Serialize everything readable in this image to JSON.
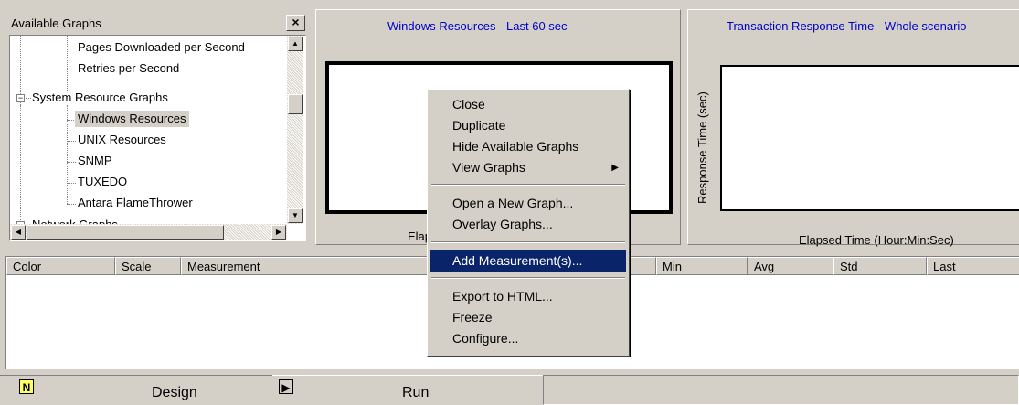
{
  "tree": {
    "title": "Available Graphs",
    "close_label": "×",
    "items": [
      {
        "label": "Pages Downloaded per Second"
      },
      {
        "label": "Retries per Second"
      },
      {
        "label": "System Resource Graphs",
        "expander": "−"
      },
      {
        "label": "Windows Resources",
        "selected": true
      },
      {
        "label": "UNIX Resources"
      },
      {
        "label": "SNMP"
      },
      {
        "label": "TUXEDO"
      },
      {
        "label": "Antara FlameThrower"
      },
      {
        "label": "Network Graphs",
        "expander": "−"
      }
    ]
  },
  "graph_windows": {
    "title": "Windows Resources - Last 60 sec",
    "xlabel_partial": "Elap"
  },
  "graph_transaction": {
    "title": "Transaction Response Time - Whole scenario",
    "ylabel": "Response Time (sec)",
    "xlabel": "Elapsed Time (Hour:Min:Sec)"
  },
  "table": {
    "columns": [
      "Color",
      "Scale",
      "Measurement",
      "Min",
      "Avg",
      "Std",
      "Last"
    ]
  },
  "context_menu": {
    "items": [
      "Close",
      "Duplicate",
      "Hide Available Graphs",
      "View Graphs",
      "Open a New Graph...",
      "Overlay Graphs...",
      "Add Measurement(s)...",
      "Export to HTML...",
      "Freeze",
      "Configure..."
    ],
    "submenu_arrow": "▶"
  },
  "tabs": {
    "design_label": "Design",
    "run_label": "Run"
  },
  "colors": {
    "background": "#d4d0c8",
    "graph_title": "#0000cc",
    "menu_highlight": "#0a246a"
  }
}
